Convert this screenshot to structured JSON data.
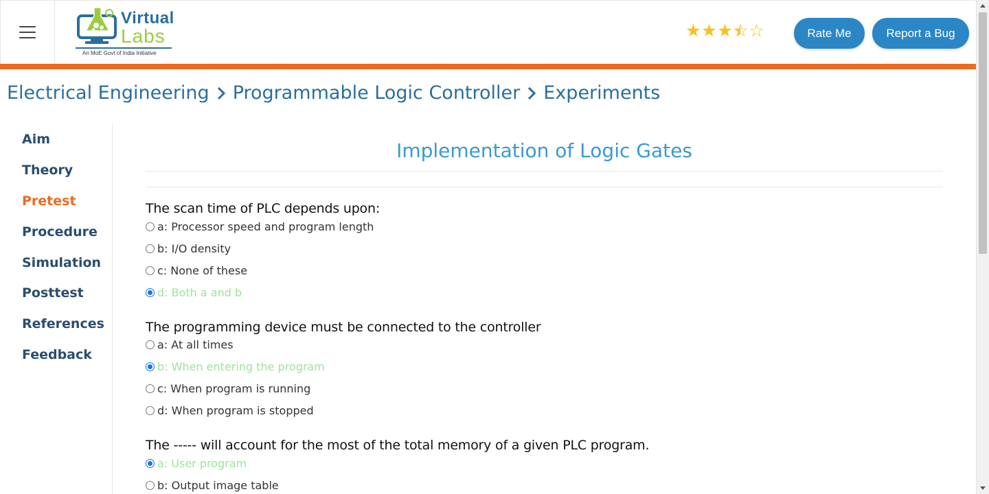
{
  "header": {
    "logo_line1": "Virtual",
    "logo_line2": "Labs",
    "logo_tagline": "An MoE Govt of India Initiative",
    "rating": 3.5,
    "rating_max": 5,
    "rate_button": "Rate Me",
    "bug_button": "Report a Bug"
  },
  "breadcrumb": [
    "Electrical Engineering",
    "Programmable Logic Controller",
    "Experiments"
  ],
  "sidebar": {
    "items": [
      {
        "label": "Aim",
        "active": false
      },
      {
        "label": "Theory",
        "active": false
      },
      {
        "label": "Pretest",
        "active": true
      },
      {
        "label": "Procedure",
        "active": false
      },
      {
        "label": "Simulation",
        "active": false
      },
      {
        "label": "Posttest",
        "active": false
      },
      {
        "label": "References",
        "active": false
      },
      {
        "label": "Feedback",
        "active": false
      }
    ]
  },
  "main": {
    "title": "Implementation of Logic Gates",
    "questions": [
      {
        "text": "The scan time of PLC depends upon:",
        "options": [
          {
            "label": "a: Processor speed and program length",
            "selected": false,
            "correct": false
          },
          {
            "label": "b: I/O density",
            "selected": false,
            "correct": false
          },
          {
            "label": "c: None of these",
            "selected": false,
            "correct": false
          },
          {
            "label": "d: Both a and b",
            "selected": true,
            "correct": true
          }
        ]
      },
      {
        "text": "The programming device must be connected to the controller",
        "options": [
          {
            "label": "a: At all times",
            "selected": false,
            "correct": false
          },
          {
            "label": "b: When entering the program",
            "selected": true,
            "correct": true
          },
          {
            "label": "c: When program is running",
            "selected": false,
            "correct": false
          },
          {
            "label": "d: When program is stopped",
            "selected": false,
            "correct": false
          }
        ]
      },
      {
        "text": "The ----- will account for the most of the total memory of a given PLC program.",
        "options": [
          {
            "label": "a: User program",
            "selected": true,
            "correct": true
          },
          {
            "label": "b: Output image table",
            "selected": false,
            "correct": false
          }
        ]
      }
    ]
  },
  "colors": {
    "accent_orange": "#ed6a1f",
    "button_blue": "#2b86c5",
    "title_blue": "#3a9ad0",
    "correct_green": "#9be39b",
    "star_gold": "#f6c21a"
  }
}
